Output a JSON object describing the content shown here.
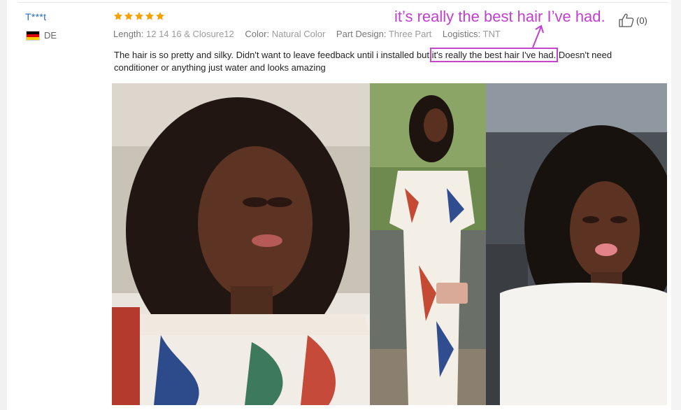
{
  "review": {
    "buyer_name": "T***t",
    "country_code": "DE",
    "rating": 5,
    "attributes": [
      {
        "label": "Length:",
        "value": "12 14 16 & Closure12"
      },
      {
        "label": "Color:",
        "value": "Natural Color"
      },
      {
        "label": "Part Design:",
        "value": "Three Part"
      },
      {
        "label": "Logistics:",
        "value": "TNT"
      }
    ],
    "text_before": "The hair is so pretty and silky. Didn't want to leave feedback until i installed but ",
    "text_highlight": "it's really the best hair I've had.",
    "text_after": " Doesn't need conditioner or anything just water and looks amazing",
    "helpful_count": "(0)",
    "photos": [
      "photo-1",
      "photo-2",
      "photo-3"
    ]
  },
  "annotation": {
    "callout_text": "it’s really the best hair I’ve had.",
    "color": "#c23fd0"
  },
  "colors": {
    "link": "#2a6ec7",
    "star": "#f5a100",
    "highlight_box": "#c447c9"
  }
}
